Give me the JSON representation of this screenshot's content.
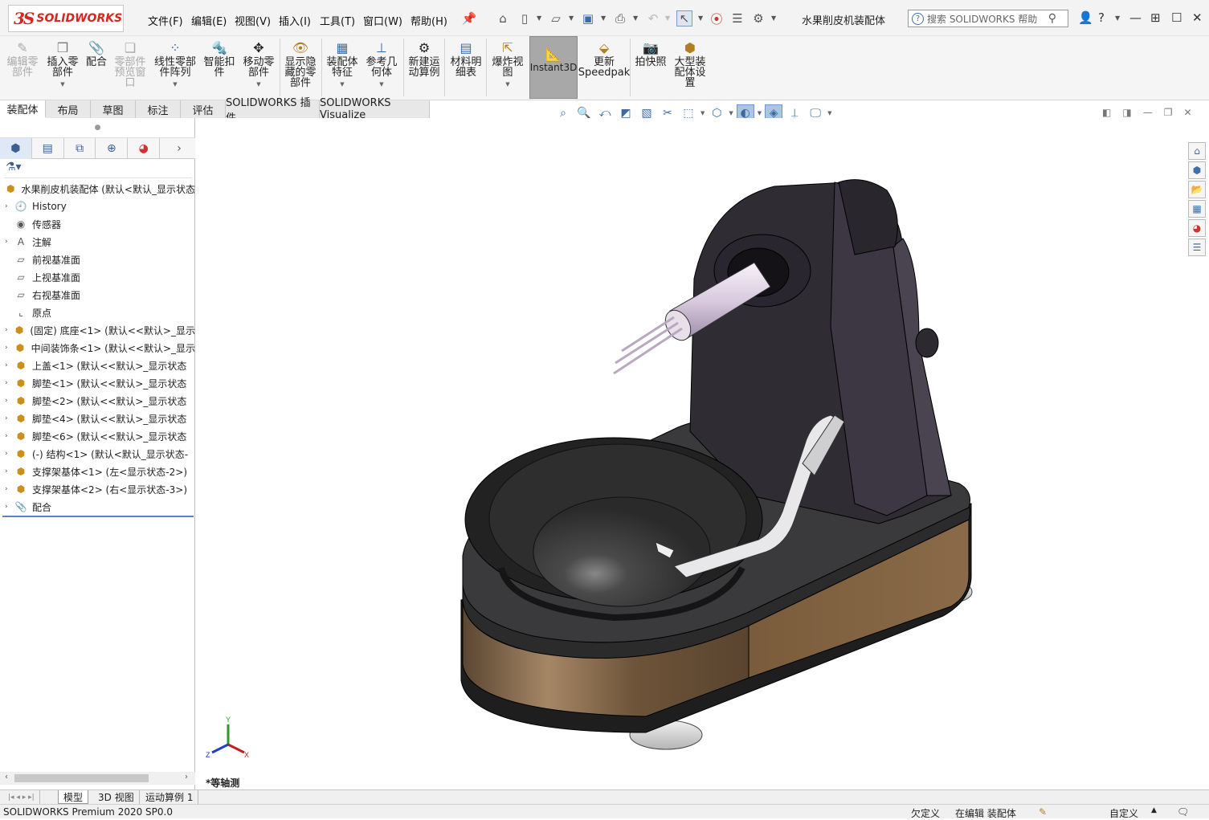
{
  "app": {
    "logo_ds": "3S",
    "logo_text": "SOLIDWORKS",
    "doc_title": "水果削皮机装配体"
  },
  "menu": [
    "文件(F)",
    "编辑(E)",
    "视图(V)",
    "插入(I)",
    "工具(T)",
    "窗口(W)",
    "帮助(H)"
  ],
  "search": {
    "placeholder": "搜索 SOLIDWORKS 帮助"
  },
  "ribbon": {
    "edit_part": "编辑零\n部件",
    "insert_part": "插入零\n部件",
    "mate": "配合",
    "part_preview": "零部件\n预览窗\n口",
    "linear_pattern": "线性零部\n件阵列",
    "smart_fastener": "智能扣\n件",
    "move_component": "移动零\n部件",
    "show_hidden": "显示隐\n藏的零\n部件",
    "assembly_features": "装配体\n特征",
    "ref_geometry": "参考几\n何体",
    "new_motion": "新建运\n动算例",
    "bom": "材料明\n细表",
    "exploded_view": "爆炸视\n图",
    "instant3d": "Instant3D",
    "speedpak": "更新\nSpeedpak",
    "snapshot": "拍快照",
    "large_assembly": "大型装\n配体设\n置"
  },
  "tabs": [
    "装配体",
    "布局",
    "草图",
    "标注",
    "评估",
    "SOLIDWORKS 插件",
    "SOLIDWORKS Visualize"
  ],
  "tree": {
    "root": "水果削皮机装配体 (默认<默认_显示状态",
    "items": [
      {
        "label": "History",
        "icon": "history-icon",
        "exp": true
      },
      {
        "label": "传感器",
        "icon": "sensor-icon",
        "exp": false
      },
      {
        "label": "注解",
        "icon": "annotation-icon",
        "exp": true
      },
      {
        "label": "前视基准面",
        "icon": "plane-icon",
        "exp": false
      },
      {
        "label": "上视基准面",
        "icon": "plane-icon",
        "exp": false
      },
      {
        "label": "右视基准面",
        "icon": "plane-icon",
        "exp": false
      },
      {
        "label": "原点",
        "icon": "origin-icon",
        "exp": false
      },
      {
        "label": "(固定) 底座<1> (默认<<默认>_显示",
        "icon": "part-icon",
        "exp": true
      },
      {
        "label": "中间装饰条<1> (默认<<默认>_显示",
        "icon": "part-icon",
        "exp": true
      },
      {
        "label": "上盖<1> (默认<<默认>_显示状态",
        "icon": "part-icon",
        "exp": true
      },
      {
        "label": "脚垫<1> (默认<<默认>_显示状态",
        "icon": "part-icon",
        "exp": true
      },
      {
        "label": "脚垫<2> (默认<<默认>_显示状态",
        "icon": "part-icon",
        "exp": true
      },
      {
        "label": "脚垫<4> (默认<<默认>_显示状态",
        "icon": "part-icon",
        "exp": true
      },
      {
        "label": "脚垫<6> (默认<<默认>_显示状态",
        "icon": "part-icon",
        "exp": true
      },
      {
        "label": "(-) 结构<1> (默认<默认_显示状态-",
        "icon": "subassembly-icon",
        "exp": true
      },
      {
        "label": "支撑架基体<1> (左<显示状态-2>)",
        "icon": "part-icon",
        "exp": true
      },
      {
        "label": "支撑架基体<2> (右<显示状态-3>)",
        "icon": "part-icon",
        "exp": true
      },
      {
        "label": "配合",
        "icon": "mates-icon",
        "exp": true
      }
    ]
  },
  "viewport": {
    "view_name": "*等轴测"
  },
  "bottom_tabs": [
    "模型",
    "3D 视图",
    "运动算例 1"
  ],
  "status": {
    "product": "SOLIDWORKS Premium 2020 SP0.0",
    "underdefined": "欠定义",
    "editing": "在编辑 装配体",
    "custom": "自定义"
  },
  "colors": {
    "accent_red": "#d6261f",
    "tree_line": "#5a84c1",
    "body_dark": "#3a3a3e",
    "band_brown": "#8a6a48"
  }
}
